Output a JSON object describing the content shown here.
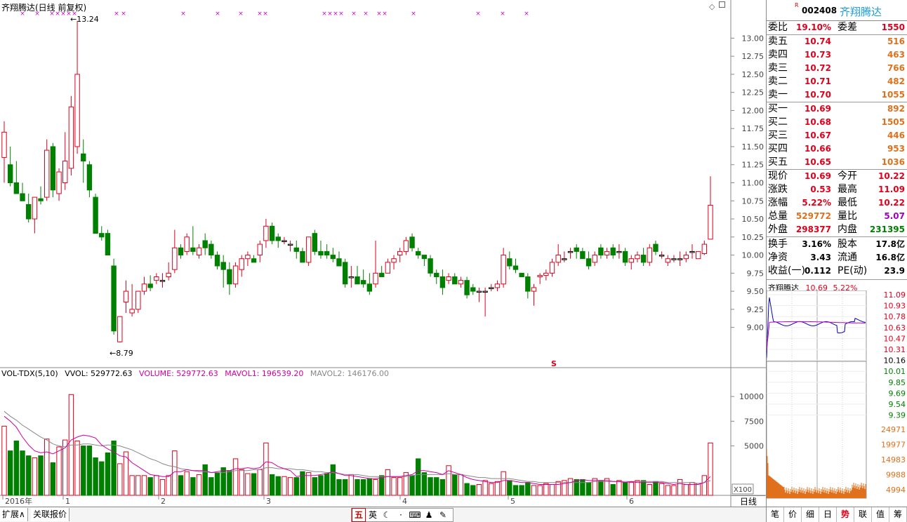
{
  "chart_title": "齐翔腾达(日线 前复权)",
  "kline": {
    "max_label": "13.24",
    "min_label": "8.79",
    "y_ticks": [
      "13.00",
      "12.75",
      "12.50",
      "12.25",
      "12.00",
      "11.75",
      "11.50",
      "11.25",
      "11.00",
      "10.75",
      "10.50",
      "10.25",
      "10.00",
      "9.75",
      "9.50",
      "9.25",
      "9.00"
    ],
    "ylim": [
      8.55,
      13.45
    ],
    "candles": [
      [
        11.35,
        11.85,
        11.0,
        11.7
      ],
      [
        11.25,
        11.5,
        10.95,
        11.0
      ],
      [
        11.0,
        11.3,
        10.85,
        10.85
      ],
      [
        10.85,
        11.0,
        10.75,
        10.75
      ],
      [
        10.7,
        10.85,
        10.45,
        10.5
      ],
      [
        10.5,
        10.8,
        10.3,
        10.8
      ],
      [
        10.78,
        10.95,
        10.7,
        10.75
      ],
      [
        10.8,
        11.6,
        10.75,
        11.45
      ],
      [
        11.5,
        11.55,
        10.8,
        10.9
      ],
      [
        10.85,
        11.2,
        10.75,
        11.15
      ],
      [
        11.0,
        11.7,
        10.9,
        11.3
      ],
      [
        11.2,
        12.2,
        11.1,
        12.05
      ],
      [
        11.5,
        13.24,
        11.4,
        12.5
      ],
      [
        11.4,
        11.6,
        11.0,
        11.3
      ],
      [
        11.25,
        11.3,
        10.8,
        10.9
      ],
      [
        10.8,
        10.85,
        10.3,
        10.3
      ],
      [
        10.3,
        10.4,
        10.2,
        10.25
      ],
      [
        10.3,
        10.35,
        10.0,
        10.0
      ],
      [
        9.85,
        9.95,
        8.9,
        8.95
      ],
      [
        8.8,
        9.15,
        8.79,
        9.15
      ],
      [
        9.35,
        9.65,
        9.2,
        9.5
      ],
      [
        9.2,
        9.6,
        9.15,
        9.25
      ],
      [
        9.25,
        9.5,
        9.2,
        9.5
      ],
      [
        9.5,
        9.7,
        9.45,
        9.6
      ],
      [
        9.6,
        9.72,
        9.5,
        9.55
      ],
      [
        9.65,
        9.75,
        9.6,
        9.7
      ],
      [
        9.65,
        9.75,
        9.55,
        9.65
      ],
      [
        9.7,
        9.9,
        9.65,
        9.75
      ],
      [
        9.8,
        10.35,
        9.75,
        10.1
      ],
      [
        10.1,
        10.15,
        9.95,
        10.0
      ],
      [
        10.05,
        10.3,
        10.0,
        10.25
      ],
      [
        10.1,
        10.4,
        10.0,
        10.05
      ],
      [
        10.0,
        10.15,
        9.95,
        10.1
      ],
      [
        10.2,
        10.3,
        10.0,
        10.1
      ],
      [
        10.15,
        10.2,
        9.95,
        10.0
      ],
      [
        10.0,
        10.05,
        9.8,
        9.85
      ],
      [
        9.9,
        10.0,
        9.55,
        9.8
      ],
      [
        9.8,
        9.9,
        9.45,
        9.6
      ],
      [
        9.6,
        9.9,
        9.55,
        9.85
      ],
      [
        9.8,
        10.0,
        9.7,
        9.95
      ],
      [
        9.95,
        10.05,
        9.85,
        10.0
      ],
      [
        9.95,
        10.0,
        9.9,
        9.9
      ],
      [
        10.0,
        10.2,
        9.9,
        10.15
      ],
      [
        10.2,
        10.5,
        10.1,
        10.4
      ],
      [
        10.4,
        10.45,
        10.15,
        10.2
      ],
      [
        10.25,
        10.3,
        10.1,
        10.2
      ],
      [
        10.2,
        10.25,
        10.15,
        10.2
      ],
      [
        10.15,
        10.2,
        10.05,
        10.15
      ],
      [
        10.1,
        10.2,
        9.95,
        10.05
      ],
      [
        10.05,
        10.1,
        9.9,
        9.9
      ],
      [
        9.9,
        10.25,
        9.85,
        10.25
      ],
      [
        10.3,
        10.35,
        10.0,
        10.05
      ],
      [
        10.05,
        10.2,
        9.95,
        10.0
      ],
      [
        10.05,
        10.15,
        9.95,
        10.0
      ],
      [
        10.0,
        10.1,
        9.9,
        9.95
      ],
      [
        9.95,
        10.05,
        9.85,
        9.85
      ],
      [
        9.9,
        9.95,
        9.55,
        9.6
      ],
      [
        9.7,
        9.85,
        9.55,
        9.7
      ],
      [
        9.7,
        9.85,
        9.6,
        9.6
      ],
      [
        9.65,
        9.8,
        9.55,
        9.6
      ],
      [
        9.6,
        9.75,
        9.45,
        9.5
      ],
      [
        9.6,
        10.2,
        9.55,
        9.75
      ],
      [
        9.75,
        9.85,
        9.7,
        9.7
      ],
      [
        9.75,
        9.95,
        9.75,
        9.9
      ],
      [
        9.9,
        10.0,
        9.8,
        9.95
      ],
      [
        10.0,
        10.1,
        9.9,
        10.05
      ],
      [
        10.05,
        10.25,
        10.0,
        10.2
      ],
      [
        10.25,
        10.3,
        10.05,
        10.1
      ],
      [
        10.05,
        10.1,
        9.95,
        10.0
      ],
      [
        10.0,
        10.0,
        9.85,
        9.95
      ],
      [
        9.95,
        10.0,
        9.7,
        9.75
      ],
      [
        9.75,
        9.8,
        9.6,
        9.7
      ],
      [
        9.7,
        9.8,
        9.45,
        9.55
      ],
      [
        9.65,
        9.75,
        9.6,
        9.7
      ],
      [
        9.7,
        9.75,
        9.6,
        9.6
      ],
      [
        9.6,
        9.7,
        9.55,
        9.65
      ],
      [
        9.65,
        9.7,
        9.4,
        9.45
      ],
      [
        9.55,
        9.6,
        9.45,
        9.5
      ],
      [
        9.5,
        9.55,
        9.35,
        9.5
      ],
      [
        9.5,
        9.55,
        9.15,
        9.5
      ],
      [
        9.55,
        9.6,
        9.5,
        9.55
      ],
      [
        9.55,
        9.65,
        9.5,
        9.6
      ],
      [
        9.6,
        10.1,
        9.55,
        10.0
      ],
      [
        9.95,
        10.05,
        9.8,
        9.85
      ],
      [
        9.85,
        9.95,
        9.75,
        9.8
      ],
      [
        9.75,
        9.75,
        9.7,
        9.7
      ],
      [
        9.7,
        9.75,
        9.4,
        9.5
      ],
      [
        9.5,
        9.6,
        9.3,
        9.55
      ],
      [
        9.7,
        9.75,
        9.6,
        9.72
      ],
      [
        9.72,
        9.8,
        9.65,
        9.75
      ],
      [
        9.75,
        9.95,
        9.7,
        9.9
      ],
      [
        9.9,
        10.15,
        9.85,
        10.0
      ],
      [
        9.95,
        10.05,
        9.9,
        9.95
      ],
      [
        10.05,
        10.1,
        9.95,
        10.05
      ],
      [
        10.1,
        10.15,
        9.95,
        10.05
      ],
      [
        10.05,
        10.1,
        9.95,
        9.95
      ],
      [
        9.95,
        10.05,
        9.8,
        9.85
      ],
      [
        9.9,
        10.05,
        9.85,
        10.0
      ],
      [
        10.1,
        10.15,
        9.95,
        10.0
      ],
      [
        10.0,
        10.1,
        9.95,
        10.05
      ],
      [
        10.1,
        10.15,
        9.95,
        10.0
      ],
      [
        10.05,
        10.15,
        9.95,
        10.05
      ],
      [
        10.05,
        10.1,
        9.85,
        9.9
      ],
      [
        9.9,
        10.0,
        9.8,
        9.95
      ],
      [
        9.95,
        10.05,
        9.9,
        10.0
      ],
      [
        10.0,
        10.1,
        9.85,
        9.9
      ],
      [
        9.9,
        10.15,
        9.85,
        10.1
      ],
      [
        10.15,
        10.2,
        10.0,
        10.05
      ],
      [
        10.0,
        10.05,
        9.95,
        10.0
      ],
      [
        9.9,
        10.0,
        9.85,
        9.95
      ],
      [
        9.95,
        10.0,
        9.9,
        9.95
      ],
      [
        9.95,
        10.05,
        9.85,
        9.95
      ],
      [
        9.95,
        10.05,
        9.9,
        10.0
      ],
      [
        10.05,
        10.15,
        9.95,
        10.05
      ],
      [
        9.95,
        10.05,
        9.95,
        10.05
      ],
      [
        10.02,
        10.2,
        10.0,
        10.15
      ],
      [
        10.22,
        11.09,
        10.22,
        10.69
      ]
    ],
    "marker_row": [
      "×",
      "×",
      "×",
      "×",
      "×",
      "×",
      "×",
      "×",
      "×",
      "×",
      "×",
      "×",
      "×",
      "×",
      "×",
      "×",
      "×",
      "×",
      "×",
      "×",
      "×",
      "×"
    ],
    "s_marker": "S"
  },
  "volume": {
    "title": "VOL-TDX(5,10)",
    "vvol": "VVOL: 529772.63",
    "volume_label": "VOLUME: 529772.63",
    "mavol1_label": "MAVOL1: 196539.20",
    "mavol2_label": "MAVOL2: 146176.00",
    "y_ticks": [
      "10000",
      "7500",
      "5000"
    ],
    "scale_label": "X100",
    "values": [
      7000,
      4500,
      5500,
      4500,
      4000,
      3800,
      4000,
      5700,
      3300,
      4900,
      5600,
      10200,
      5500,
      5000,
      5000,
      3800,
      3400,
      4300,
      5500,
      3200,
      4400,
      2000,
      2000,
      2000,
      1800,
      2000,
      1600,
      2000,
      4500,
      2000,
      2400,
      1800,
      2100,
      3100,
      1800,
      2300,
      2800,
      2500,
      3700,
      2600,
      2200,
      2200,
      2600,
      5300,
      2100,
      1900,
      1900,
      1800,
      1800,
      2400,
      2300,
      1800,
      2000,
      2200,
      3100,
      1600,
      1600,
      2100,
      1600,
      1600,
      1700,
      1600,
      2000,
      2600,
      1800,
      1800,
      2300,
      2000,
      3700,
      2300,
      1800,
      1800,
      1600,
      3000,
      2100,
      2100,
      1200,
      1000,
      1100,
      1500,
      1200,
      1400,
      2400,
      1500,
      1000,
      1000,
      1300,
      1000,
      1000,
      1200,
      1100,
      1400,
      1500,
      1700,
      1600,
      1600,
      1300,
      1700,
      1500,
      1700,
      1100,
      1500,
      1300,
      1300,
      1500,
      1500,
      1100,
      1400,
      1200,
      1000,
      1000,
      1600,
      1100,
      1300,
      1200,
      2000,
      5300
    ],
    "mavol1": [
      8000,
      7500,
      6900,
      5900,
      5100,
      4500,
      4300,
      4400,
      4200,
      4500,
      4800,
      5600,
      5900,
      6100,
      6000,
      5800,
      5100,
      4700,
      4400,
      4000,
      3900,
      3300,
      2900,
      2500,
      2100,
      2000,
      1900,
      1900,
      2400,
      2400,
      2600,
      2500,
      2500,
      2500,
      2300,
      2400,
      2500,
      2500,
      2700,
      2700,
      2800,
      2700,
      2800,
      3400,
      3300,
      2900,
      2700,
      2500,
      1900,
      2000,
      2000,
      2000,
      2100,
      2200,
      2400,
      2200,
      2000,
      2000,
      1900,
      1800,
      1700,
      1700,
      1800,
      1900,
      1900,
      1900,
      2000,
      2100,
      2500,
      2500,
      2400,
      2300,
      2100,
      2500,
      2300,
      2100,
      1800,
      1600,
      1500,
      1400,
      1300,
      1300,
      1500,
      1500,
      1400,
      1300,
      1300,
      1200,
      1100,
      1100,
      1100,
      1100,
      1200,
      1300,
      1500,
      1600,
      1500,
      1500,
      1500,
      1500,
      1400,
      1400,
      1300,
      1400,
      1300,
      1300,
      1300,
      1300,
      1300,
      1200,
      1100,
      1200,
      1100,
      1100,
      1100,
      1300,
      1900
    ],
    "mavol2": [
      8500,
      8000,
      7600,
      7100,
      6700,
      6300,
      5900,
      5600,
      5200,
      5000,
      4900,
      5100,
      5100,
      5200,
      5200,
      5100,
      5000,
      5100,
      5100,
      5000,
      4800,
      4600,
      4300,
      4000,
      3700,
      3500,
      3200,
      3000,
      2900,
      2700,
      2600,
      2500,
      2400,
      2400,
      2300,
      2300,
      2300,
      2400,
      2500,
      2500,
      2500,
      2600,
      2600,
      2800,
      2800,
      2700,
      2700,
      2700,
      2600,
      2600,
      2500,
      2400,
      2400,
      2300,
      2300,
      2200,
      2100,
      2100,
      2100,
      2000,
      1900,
      1900,
      1900,
      1900,
      1900,
      1900,
      1900,
      2000,
      2100,
      2100,
      2100,
      2100,
      2100,
      2200,
      2100,
      2100,
      2000,
      1900,
      1800,
      1800,
      1700,
      1700,
      1700,
      1700,
      1600,
      1500,
      1400,
      1400,
      1300,
      1300,
      1300,
      1300,
      1300,
      1300,
      1300,
      1300,
      1300,
      1400,
      1400,
      1400,
      1400,
      1400,
      1400,
      1400,
      1400,
      1400,
      1400,
      1400,
      1400,
      1300,
      1300,
      1300,
      1300,
      1300,
      1200,
      1300,
      1500
    ]
  },
  "x_axis": [
    "2016年",
    "1",
    "2",
    "3",
    "4",
    "5",
    "6"
  ],
  "bottom": {
    "tab_expand": "扩展∧",
    "tab_related": "关联报价",
    "toolbar": [
      "五",
      "英",
      "☾",
      "·",
      "♦",
      "⌨",
      "♟",
      "♞",
      "✎"
    ],
    "period": "日线"
  },
  "quote": {
    "r_mark": "R",
    "code": "002408",
    "name": "齐翔腾达",
    "weibi_label": "委比",
    "weibi": "19.10%",
    "weicha_label": "委差",
    "weicha": "1550",
    "sells": [
      {
        "label": "卖五",
        "price": "10.74",
        "vol": "516"
      },
      {
        "label": "卖四",
        "price": "10.73",
        "vol": "463"
      },
      {
        "label": "卖三",
        "price": "10.72",
        "vol": "766"
      },
      {
        "label": "卖二",
        "price": "10.71",
        "vol": "482"
      },
      {
        "label": "卖一",
        "price": "10.70",
        "vol": "1055"
      }
    ],
    "buys": [
      {
        "label": "买一",
        "price": "10.69",
        "vol": "892"
      },
      {
        "label": "买二",
        "price": "10.68",
        "vol": "1505"
      },
      {
        "label": "买三",
        "price": "10.67",
        "vol": "446"
      },
      {
        "label": "买四",
        "price": "10.66",
        "vol": "953"
      },
      {
        "label": "买五",
        "price": "10.65",
        "vol": "1036"
      }
    ],
    "stats": [
      {
        "l1": "现价",
        "v1": "10.69",
        "l2": "今开",
        "v2": "10.22",
        "c1": "red",
        "c2": "red"
      },
      {
        "l1": "涨跌",
        "v1": "0.53",
        "l2": "最高",
        "v2": "11.09",
        "c1": "red",
        "c2": "red"
      },
      {
        "l1": "涨幅",
        "v1": "5.22%",
        "l2": "最低",
        "v2": "10.22",
        "c1": "red",
        "c2": "red"
      },
      {
        "l1": "总量",
        "v1": "529772",
        "l2": "量比",
        "v2": "5.07",
        "c1": "orange",
        "c2": "purple"
      },
      {
        "l1": "外盘",
        "v1": "298377",
        "l2": "内盘",
        "v2": "231395",
        "c1": "red",
        "c2": "green"
      }
    ],
    "fund": [
      {
        "l1": "换手",
        "v1": "3.16%",
        "l2": "股本",
        "v2": "17.8亿"
      },
      {
        "l1": "净资",
        "v1": "3.43",
        "l2": "流通",
        "v2": "16.8亿"
      },
      {
        "l1": "收益(一)",
        "v1": "0.112",
        "l2": "PE(动)",
        "v2": "23.9"
      }
    ]
  },
  "mini": {
    "name": "齐翔腾达",
    "price": "10.69",
    "pct": "5.22%",
    "price_ticks": [
      "11.09",
      "10.93",
      "10.78",
      "10.63",
      "10.47",
      "10.31",
      "10.16",
      "10.01",
      "9.85",
      "9.69",
      "9.54",
      "9.39"
    ],
    "vol_ticks": [
      "24971",
      "19977",
      "14983",
      "9988",
      "4994"
    ]
  },
  "right_tabs": [
    "笔",
    "价",
    "细",
    "日",
    "势",
    "联",
    "值",
    "筹"
  ]
}
